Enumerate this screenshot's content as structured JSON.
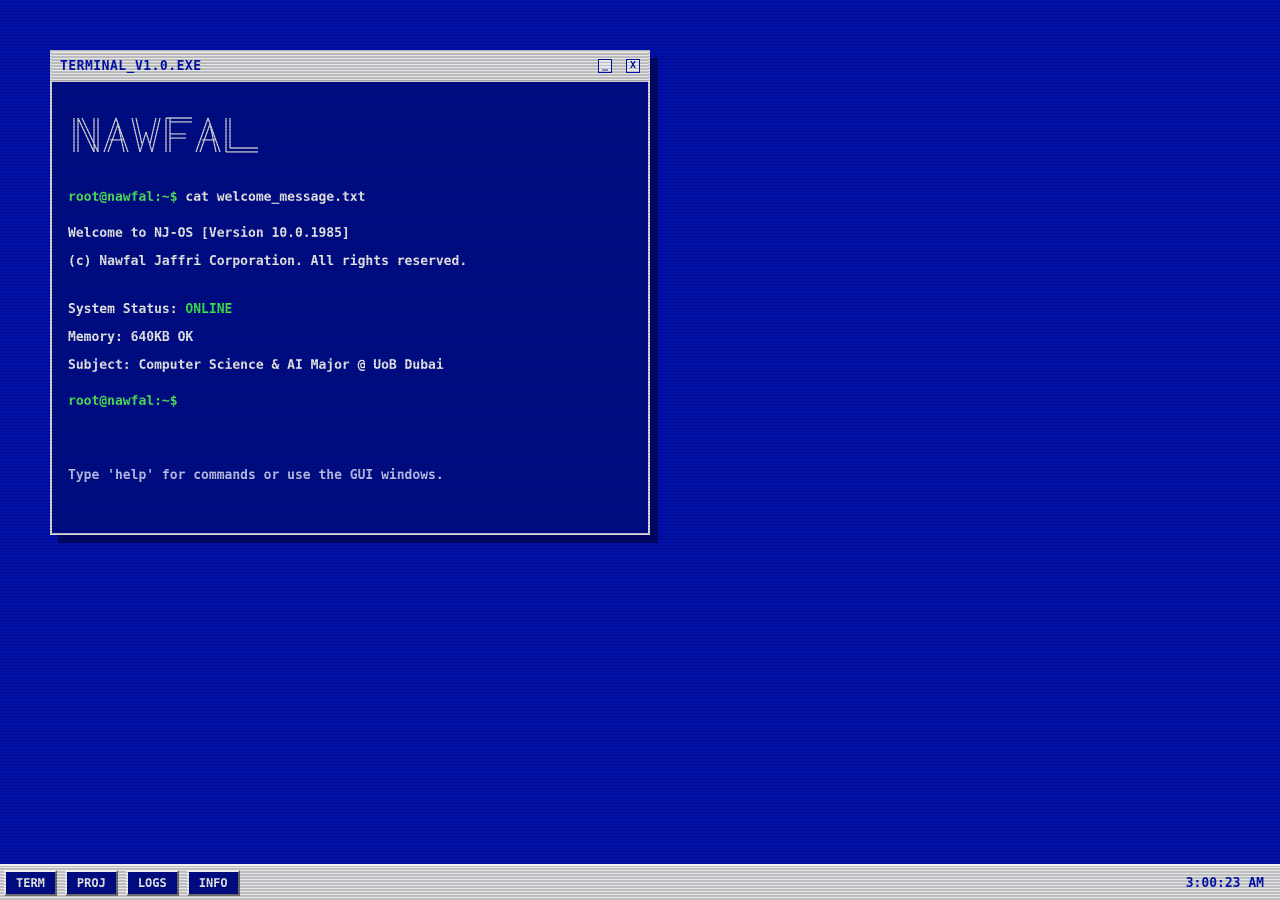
{
  "window": {
    "title": "TERMINAL_V1.0.EXE",
    "minimize_label": "_",
    "close_label": "X"
  },
  "ascii_logo": "NAWFAL",
  "terminal": {
    "prompt": "root@nawfal:~$",
    "command": " cat welcome_message.txt",
    "welcome_line": "Welcome to NJ-OS [Version 10.0.1985]",
    "copyright_line": "(c) Nawfal Jaffri Corporation. All rights reserved.",
    "status_label": "System Status: ",
    "status_value": "ONLINE",
    "memory_line": "Memory: 640KB OK",
    "subject_line": "Subject: Computer Science & AI Major @ UoB Dubai",
    "hint": "Type 'help' for commands or use the GUI windows."
  },
  "taskbar": {
    "buttons": [
      "TERM",
      "PROJ",
      "LOGS",
      "INFO"
    ],
    "clock": "3:00:23 AM"
  },
  "colors": {
    "desktop": "#0010a8",
    "terminal_bg": "#000c84",
    "prompt": "#4ee05a",
    "status_ok": "#3ce04a"
  }
}
